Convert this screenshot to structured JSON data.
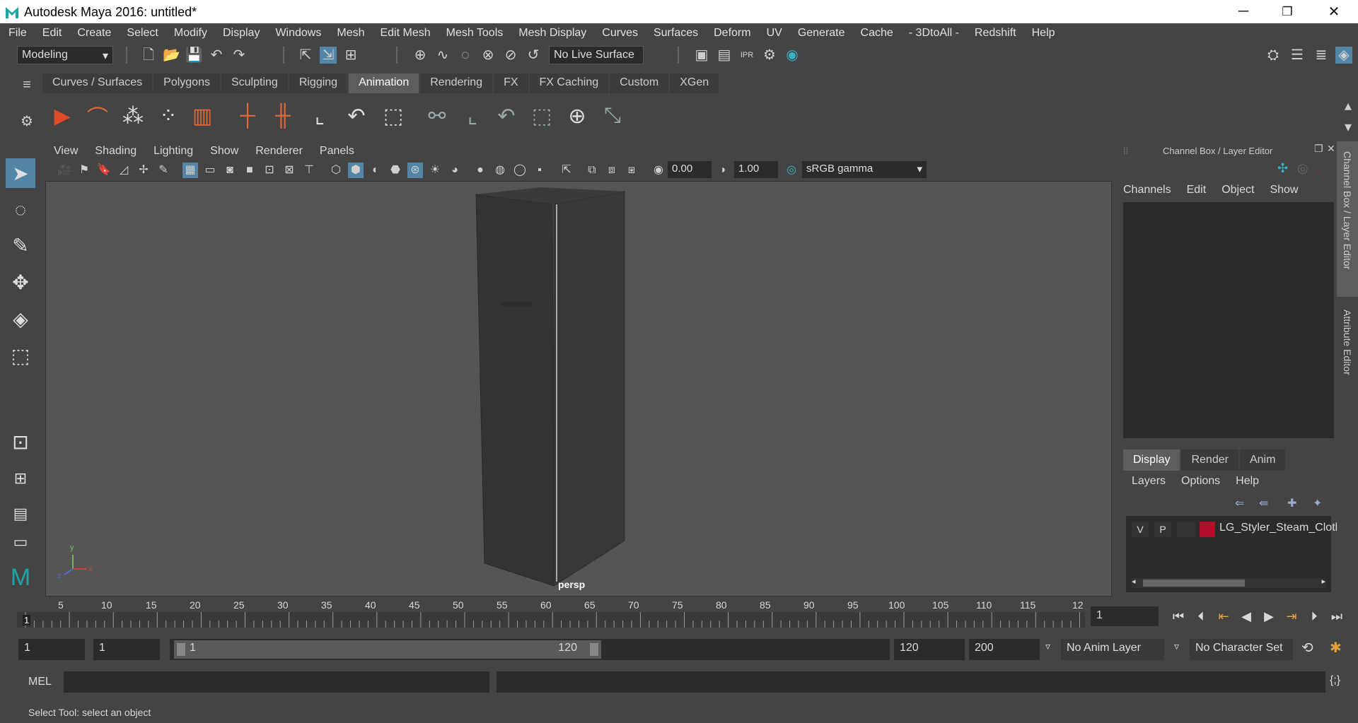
{
  "window": {
    "title": "Autodesk Maya 2016: untitled*",
    "minimize": "─",
    "maximize": "❐",
    "close": "✕"
  },
  "menubar": [
    "File",
    "Edit",
    "Create",
    "Select",
    "Modify",
    "Display",
    "Windows",
    "Mesh",
    "Edit Mesh",
    "Mesh Tools",
    "Mesh Display",
    "Curves",
    "Surfaces",
    "Deform",
    "UV",
    "Generate",
    "Cache",
    "- 3DtoAll -",
    "Redshift",
    "Help"
  ],
  "statusline": {
    "mode": "Modeling",
    "live_surface": "No Live Surface"
  },
  "shelf": {
    "tabs": [
      "Curves / Surfaces",
      "Polygons",
      "Sculpting",
      "Rigging",
      "Animation",
      "Rendering",
      "FX",
      "FX Caching",
      "Custom",
      "XGen"
    ],
    "active_tab": "Animation"
  },
  "viewport": {
    "menu": [
      "View",
      "Shading",
      "Lighting",
      "Show",
      "Renderer",
      "Panels"
    ],
    "exposure": "0.00",
    "gamma": "1.00",
    "color_space": "sRGB gamma",
    "camera_label": "persp",
    "axis_y": "y",
    "axis_z": "z",
    "axis_x": "x"
  },
  "channel_box": {
    "header": "Channel Box / Layer Editor",
    "menu": [
      "Channels",
      "Edit",
      "Object",
      "Show"
    ],
    "side_tab_1": "Channel Box / Layer Editor",
    "side_tab_2": "Attribute Editor"
  },
  "layer_editor": {
    "tabs": [
      "Display",
      "Render",
      "Anim"
    ],
    "active_tab": "Display",
    "menu": [
      "Layers",
      "Options",
      "Help"
    ],
    "layer": {
      "v": "V",
      "p": "P",
      "name": "LG_Styler_Steam_Cloth",
      "color": "#b0102a"
    }
  },
  "timeline": {
    "ticks": [
      "5",
      "10",
      "15",
      "20",
      "25",
      "30",
      "35",
      "40",
      "45",
      "50",
      "55",
      "60",
      "65",
      "70",
      "75",
      "80",
      "85",
      "90",
      "95",
      "100",
      "105",
      "110",
      "115",
      "12"
    ],
    "current_marker": "1",
    "current_frame": "1"
  },
  "range": {
    "start": "1",
    "playback_start": "1",
    "slider_start": "1",
    "slider_end": "120",
    "playback_end": "120",
    "end": "200",
    "anim_layer": "No Anim Layer",
    "character_set": "No Character Set"
  },
  "command_line": {
    "label": "MEL"
  },
  "help_line": {
    "text": "Select Tool: select an object"
  },
  "colors": {
    "ui_bg": "#444444",
    "viewport_bg": "#555555",
    "active_tab": "#5d5d5d",
    "highlight_blue": "#5285a6",
    "maya_logo": "#1aa6a6"
  }
}
